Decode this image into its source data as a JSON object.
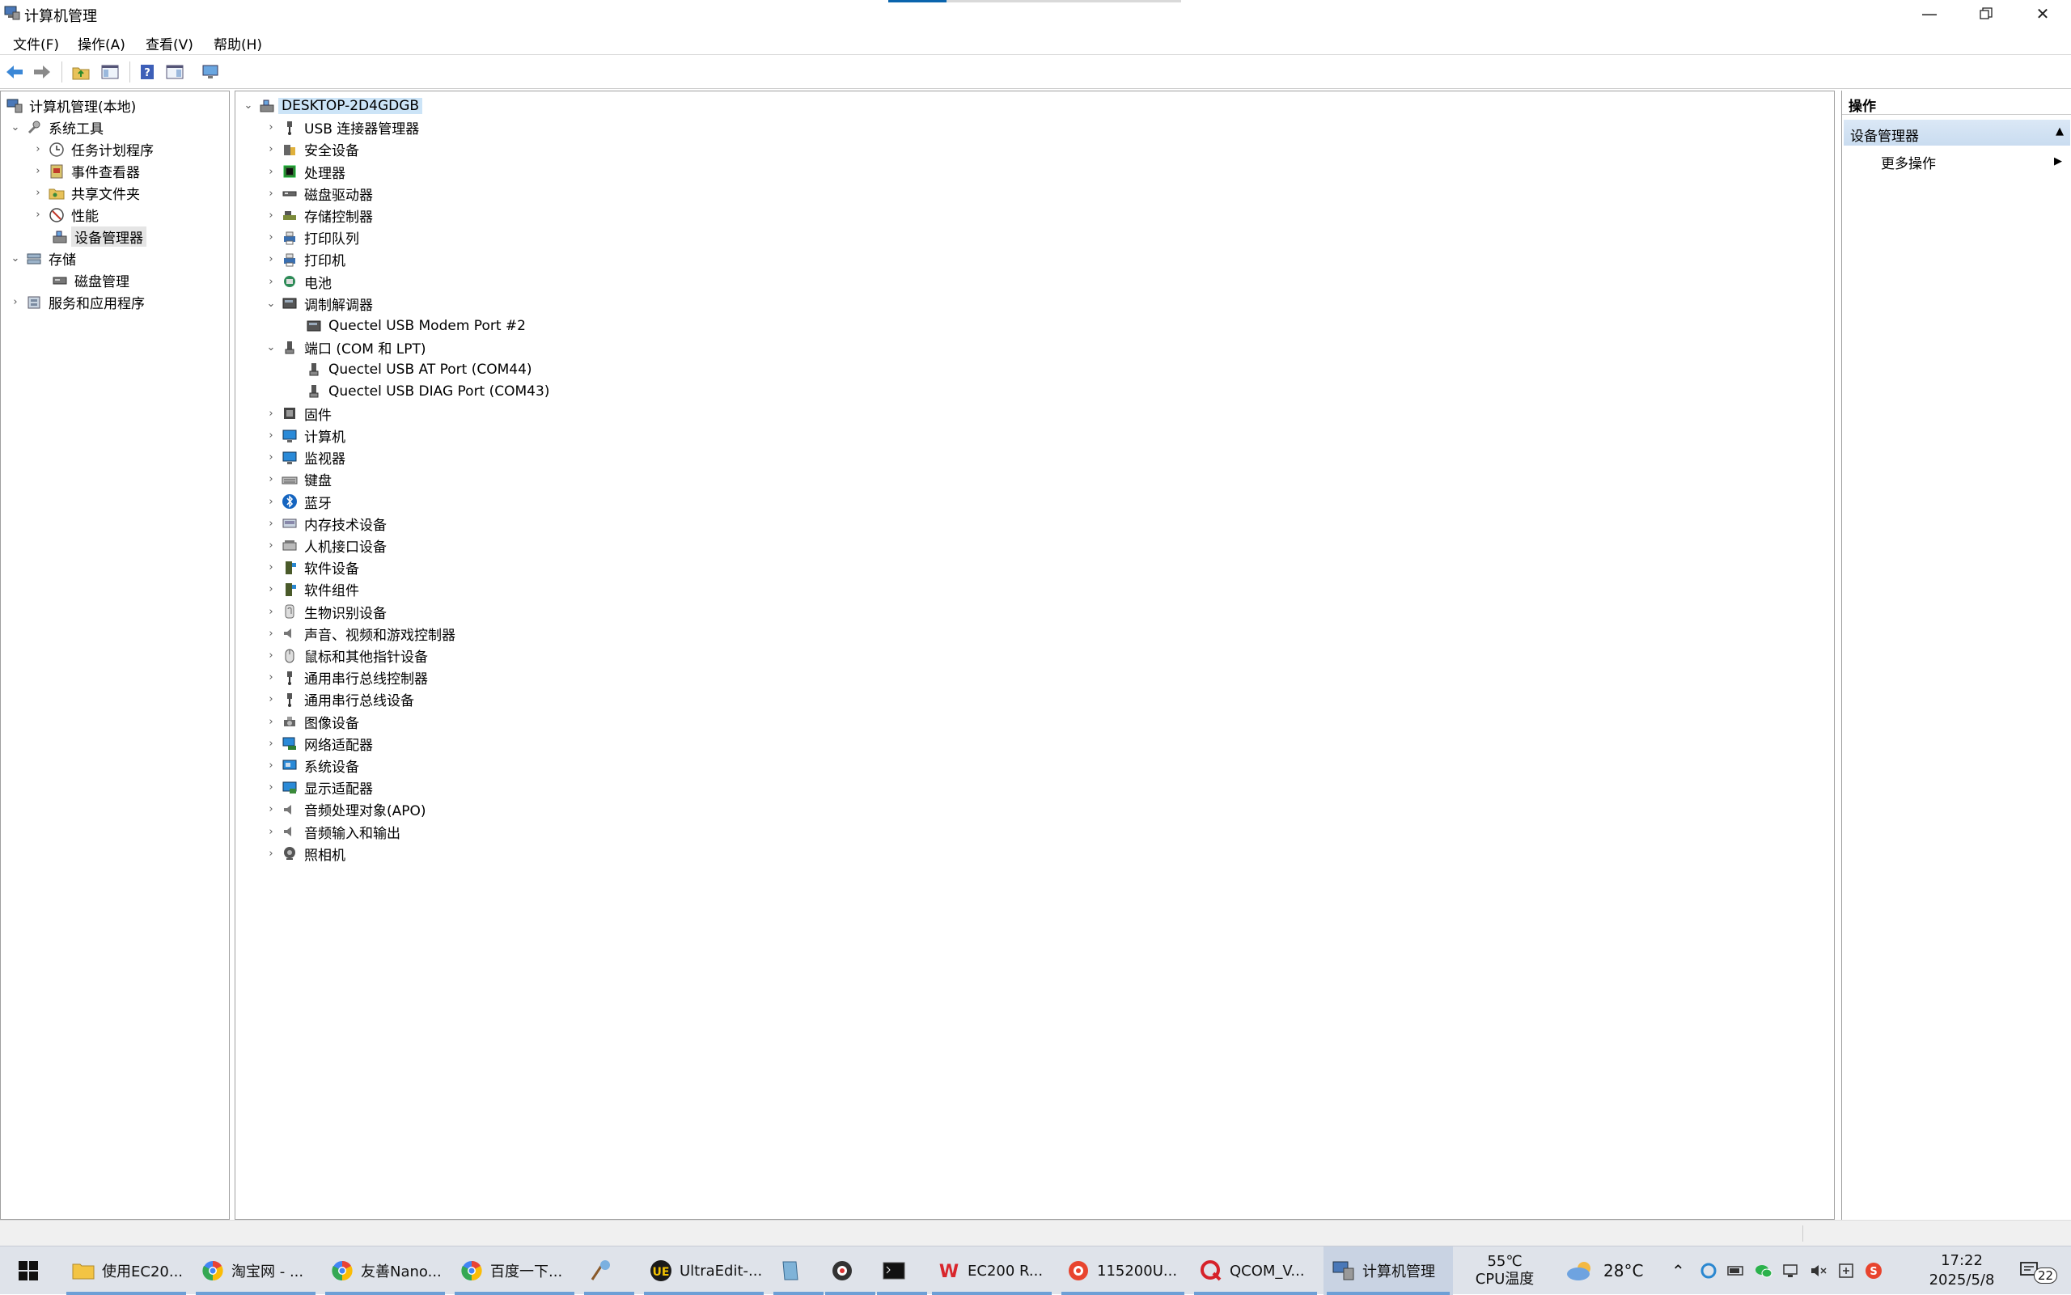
{
  "window": {
    "title": "计算机管理",
    "menu": [
      "文件(F)",
      "操作(A)",
      "查看(V)",
      "帮助(H)"
    ]
  },
  "left_tree": {
    "root": "计算机管理(本地)",
    "system_tools": "系统工具",
    "task_scheduler": "任务计划程序",
    "event_viewer": "事件查看器",
    "shared_folders": "共享文件夹",
    "performance": "性能",
    "device_manager": "设备管理器",
    "storage": "存储",
    "disk_management": "磁盘管理",
    "services_apps": "服务和应用程序"
  },
  "devices": {
    "root": "DESKTOP-2D4GDGB",
    "usb_connector": "USB 连接器管理器",
    "security": "安全设备",
    "processor": "处理器",
    "disk_drives": "磁盘驱动器",
    "storage_ctrl": "存储控制器",
    "print_queue": "打印队列",
    "printer": "打印机",
    "battery": "电池",
    "modem": "调制解调器",
    "modem_port": "Quectel USB Modem Port #2",
    "ports": "端口 (COM 和 LPT)",
    "at_port": "Quectel USB AT Port (COM44)",
    "diag_port": "Quectel USB DIAG Port (COM43)",
    "firmware": "固件",
    "computer": "计算机",
    "monitor": "监视器",
    "keyboard": "键盘",
    "bluetooth": "蓝牙",
    "memory_tech": "内存技术设备",
    "hid": "人机接口设备",
    "software_dev": "软件设备",
    "software_comp": "软件组件",
    "biometric": "生物识别设备",
    "sound": "声音、视频和游戏控制器",
    "mouse": "鼠标和其他指针设备",
    "usb_ctrl": "通用串行总线控制器",
    "usb_dev": "通用串行总线设备",
    "imaging": "图像设备",
    "network": "网络适配器",
    "system_dev": "系统设备",
    "display": "显示适配器",
    "apo": "音频处理对象(APO)",
    "audio_io": "音频输入和输出",
    "camera": "照相机"
  },
  "actions": {
    "header": "操作",
    "section": "设备管理器",
    "more": "更多操作"
  },
  "taskbar": {
    "apps": [
      {
        "label": "使用EC20..."
      },
      {
        "label": "淘宝网 - ..."
      },
      {
        "label": "友善Nano..."
      },
      {
        "label": "百度一下..."
      },
      {
        "label": ""
      },
      {
        "label": "UltraEdit-..."
      },
      {
        "label": ""
      },
      {
        "label": ""
      },
      {
        "label": ""
      },
      {
        "label": "EC200   R..."
      },
      {
        "label": "115200U..."
      },
      {
        "label": "QCOM_V..."
      },
      {
        "label": "计算机管理"
      }
    ],
    "cpu_temp": "55℃",
    "cpu_label": "CPU温度",
    "weather": "28°C",
    "time": "17:22",
    "date": "2025/5/8",
    "notifications": "22"
  },
  "colors": {
    "accent": "#0a64ad",
    "selection": "#cce4f7",
    "taskbar": "#dfe3ea"
  }
}
